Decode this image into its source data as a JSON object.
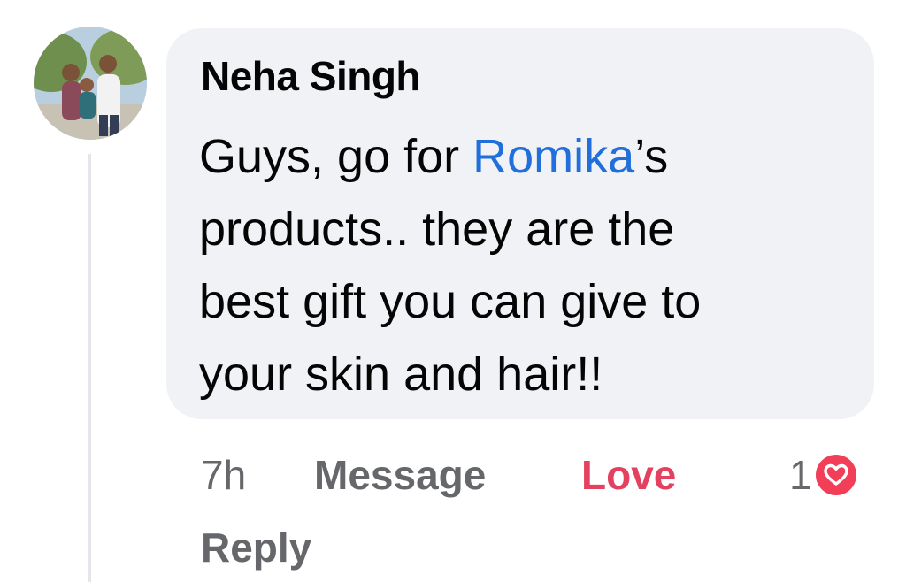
{
  "comment": {
    "author": "Neha Singh",
    "text_lines": [
      {
        "before": "Guys, go for ",
        "mention": "Romika",
        "after": "’s"
      },
      {
        "text": "products.. they are the"
      },
      {
        "text": "best gift you can give to"
      },
      {
        "text": "your skin and hair!!"
      }
    ],
    "time": "7h",
    "actions": {
      "message": "Message",
      "love": "Love",
      "reply": "Reply"
    },
    "reaction": {
      "count": "1",
      "icon": "heart-icon"
    }
  },
  "colors": {
    "bubble": "#f0f2f5",
    "mention": "#216fdb",
    "love": "#e4405f",
    "heart_badge": "#f33e58",
    "muted": "#65676b"
  }
}
